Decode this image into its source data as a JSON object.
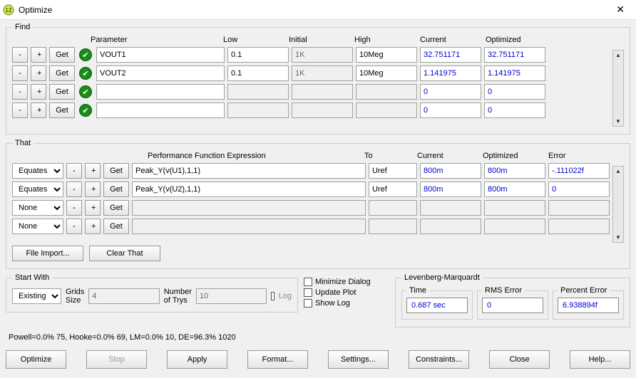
{
  "window": {
    "title": "Optimize"
  },
  "find": {
    "headers": {
      "parameter": "Parameter",
      "low": "Low",
      "initial": "Initial",
      "high": "High",
      "current": "Current",
      "optimized": "Optimized"
    },
    "btn": {
      "minus": "-",
      "plus": "+",
      "get": "Get"
    },
    "rows": [
      {
        "param": "VOUT1",
        "low": "0.1",
        "initial": "1K",
        "high": "10Meg",
        "current": "32.751171",
        "optimized": "32.751171"
      },
      {
        "param": "VOUT2",
        "low": "0.1",
        "initial": "1K",
        "high": "10Meg",
        "current": "1.141975",
        "optimized": "1.141975"
      },
      {
        "param": "",
        "low": "",
        "initial": "",
        "high": "",
        "current": "0",
        "optimized": "0"
      },
      {
        "param": "",
        "low": "",
        "initial": "",
        "high": "",
        "current": "0",
        "optimized": "0"
      }
    ]
  },
  "that": {
    "headers": {
      "expr": "Performance Function Expression",
      "to": "To",
      "current": "Current",
      "optimized": "Optimized",
      "error": "Error"
    },
    "options": {
      "equates": "Equates",
      "none": "None"
    },
    "rows": [
      {
        "sel": "Equates",
        "expr": "Peak_Y(v(U1),1,1)",
        "to": "Uref",
        "current": "800m",
        "optimized": "800m",
        "error": "-.111022f"
      },
      {
        "sel": "Equates",
        "expr": "Peak_Y(v(U2),1,1)",
        "to": "Uref",
        "current": "800m",
        "optimized": "800m",
        "error": "0"
      },
      {
        "sel": "None",
        "expr": "",
        "to": "",
        "current": "",
        "optimized": "",
        "error": ""
      },
      {
        "sel": "None",
        "expr": "",
        "to": "",
        "current": "",
        "optimized": "",
        "error": ""
      }
    ],
    "file_import": "File Import...",
    "clear": "Clear That"
  },
  "startwith": {
    "legend": "Start With",
    "mode": "Existing",
    "grids_label": "Grids Size",
    "grids": "4",
    "trys_label": "Number of Trys",
    "trys": "10",
    "log": "Log"
  },
  "checks": {
    "minimize": "Minimize Dialog",
    "update": "Update Plot",
    "show": "Show Log"
  },
  "lm": {
    "legend": "Levenberg-Marquardt",
    "time_label": "Time",
    "time": "0.687 sec",
    "rms_label": "RMS Error",
    "rms": "0",
    "pct_label": "Percent Error",
    "pct": "6.938894f"
  },
  "status": "Powell=0.0% 75, Hooke=0.0% 69, LM=0.0% 10, DE=96.3% 1020",
  "buttons": {
    "optimize": "Optimize",
    "stop": "Stop",
    "apply": "Apply",
    "format": "Format...",
    "settings": "Settings...",
    "constraints": "Constraints...",
    "close": "Close",
    "help": "Help..."
  }
}
